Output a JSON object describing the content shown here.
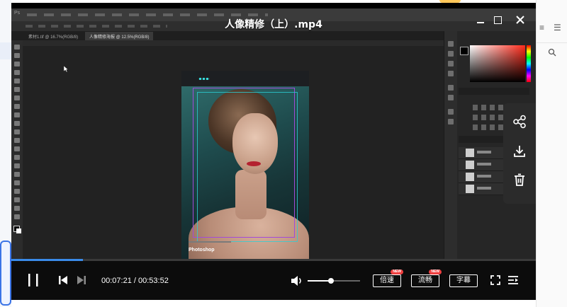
{
  "player": {
    "title": "人像精修（上）.mp4",
    "current_time": "00:07:21",
    "duration": "00:53:52",
    "time_display": "00:07:21 / 00:53:52",
    "progress": 0.136,
    "volume": 0.45,
    "speed_label": "倍速",
    "quality_label": "流畅",
    "subtitle_label": "字幕",
    "new_badge": "NEW",
    "accent_color": "#3a8be8"
  },
  "window_controls": {
    "minimize": "minimize-icon",
    "maximize": "maximize-icon",
    "close": "close-icon"
  },
  "video_frame": {
    "app": "Photoshop",
    "art_caption": "Photoshop",
    "document_tab_active": "人像精修海报 @ 12.5%(RGB/8)",
    "document_tab_other": "素材1.tif @ 16.7%(RGB/8)"
  },
  "share_panel": {
    "share": "share-icon",
    "download": "download-icon",
    "delete": "trash-icon"
  },
  "background_page": {
    "right_icons": [
      "list-icon",
      "search-icon"
    ]
  }
}
